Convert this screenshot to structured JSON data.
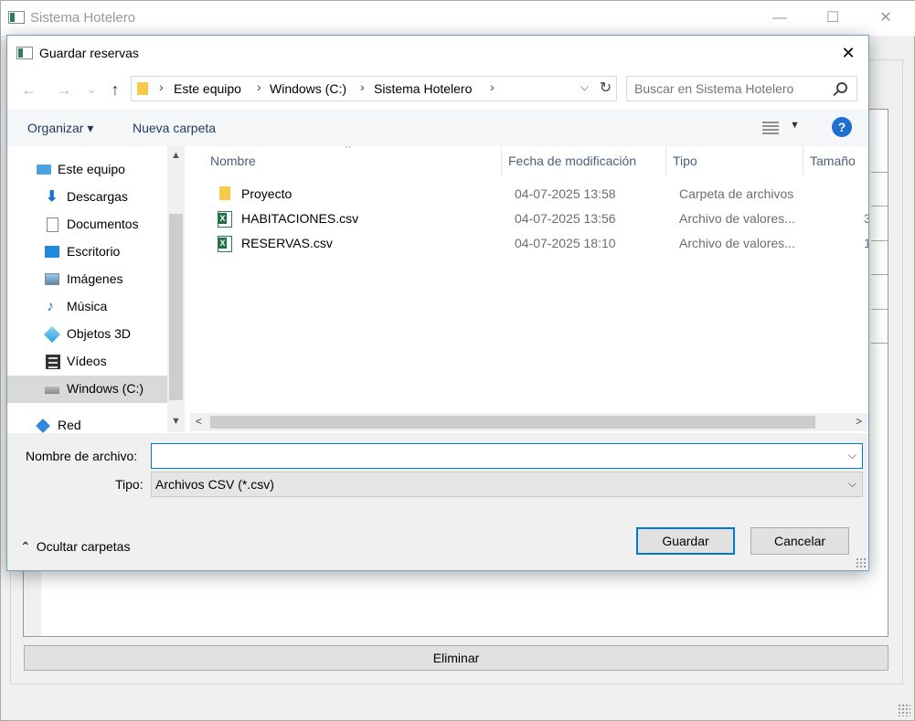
{
  "main_window": {
    "title": "Sistema Hotelero",
    "minimize": "—",
    "maximize": "☐",
    "close": "✕",
    "delete_button": "Eliminar"
  },
  "dialog": {
    "title": "Guardar reservas",
    "close": "✕",
    "nav": {
      "back": "←",
      "forward": "→",
      "recent": "⌄",
      "up": "↑",
      "refresh": "↻"
    },
    "breadcrumb": [
      "Este equipo",
      "Windows (C:)",
      "Sistema Hotelero"
    ],
    "breadcrumb_sep": "›",
    "search_placeholder": "Buscar en Sistema Hotelero",
    "toolbar": {
      "organize": "Organizar ▾",
      "new_folder": "Nueva carpeta",
      "help": "?"
    },
    "nav_pane": [
      {
        "label": "Este equipo",
        "icon": "computer-icon"
      },
      {
        "label": "Descargas",
        "icon": "download-icon"
      },
      {
        "label": "Documentos",
        "icon": "document-icon"
      },
      {
        "label": "Escritorio",
        "icon": "desktop-icon"
      },
      {
        "label": "Imágenes",
        "icon": "image-icon"
      },
      {
        "label": "Música",
        "icon": "music-icon"
      },
      {
        "label": "Objetos 3D",
        "icon": "cube-icon"
      },
      {
        "label": "Vídeos",
        "icon": "video-icon"
      },
      {
        "label": "Windows (C:)",
        "icon": "drive-icon",
        "selected": true
      },
      {
        "label": "Red",
        "icon": "network-icon"
      }
    ],
    "columns": [
      "Nombre",
      "Fecha de modificación",
      "Tipo",
      "Tamaño"
    ],
    "files": [
      {
        "name": "Proyecto",
        "date": "04-07-2025 13:58",
        "type": "Carpeta de archivos",
        "size": "",
        "icon": "folder-icon"
      },
      {
        "name": "HABITACIONES.csv",
        "date": "04-07-2025 13:56",
        "type": "Archivo de valores...",
        "size": "3",
        "icon": "excel-csv-icon"
      },
      {
        "name": "RESERVAS.csv",
        "date": "04-07-2025 18:10",
        "type": "Archivo de valores...",
        "size": "1",
        "icon": "excel-csv-icon"
      }
    ],
    "filename_label": "Nombre de archivo:",
    "filename_value": "",
    "type_label": "Tipo:",
    "type_value": "Archivos CSV (*.csv)",
    "hide_folders": "Ocultar carpetas",
    "save_button": "Guardar",
    "cancel_button": "Cancelar"
  }
}
